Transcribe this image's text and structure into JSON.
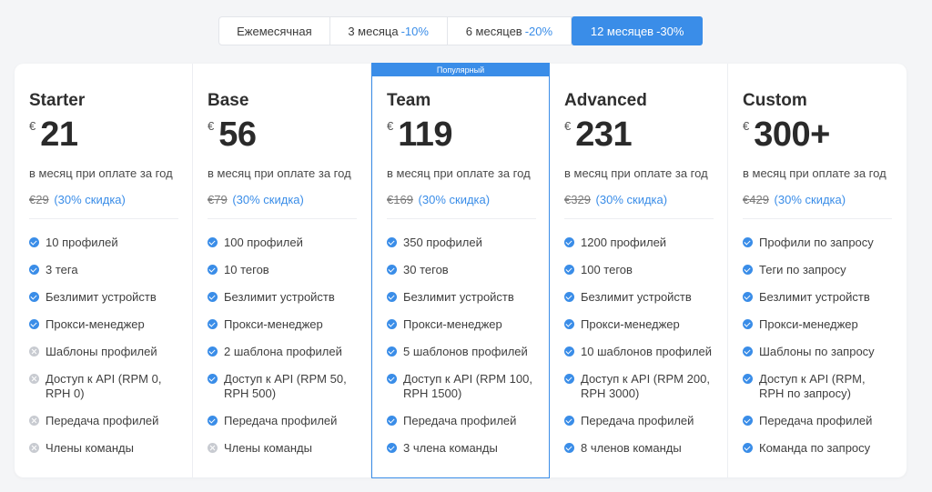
{
  "periods": [
    {
      "label": "Ежемесячная",
      "discount": ""
    },
    {
      "label": "3 месяца",
      "discount": "-10%"
    },
    {
      "label": "6 месяцев",
      "discount": "-20%"
    },
    {
      "label": "12 месяцев",
      "discount": "-30%",
      "active": true
    }
  ],
  "popular_badge": "Популярный",
  "currency": "€",
  "price_note": "в месяц при оплате за год",
  "discount_label": "(30% скидка)",
  "plans": [
    {
      "name": "Starter",
      "price": "21",
      "old_price": "€29",
      "features": [
        {
          "text": "10 профилей",
          "included": true
        },
        {
          "text": "3 тега",
          "included": true
        },
        {
          "text": "Безлимит устройств",
          "included": true
        },
        {
          "text": "Прокси-менеджер",
          "included": true
        },
        {
          "text": "Шаблоны профилей",
          "included": false
        },
        {
          "text": "Доступ к API (RPM 0, RPH 0)",
          "included": false
        },
        {
          "text": "Передача профилей",
          "included": false
        },
        {
          "text": "Члены команды",
          "included": false
        }
      ]
    },
    {
      "name": "Base",
      "price": "56",
      "old_price": "€79",
      "features": [
        {
          "text": "100 профилей",
          "included": true
        },
        {
          "text": "10 тегов",
          "included": true
        },
        {
          "text": "Безлимит устройств",
          "included": true
        },
        {
          "text": "Прокси-менеджер",
          "included": true
        },
        {
          "text": "2 шаблона профилей",
          "included": true
        },
        {
          "text": "Доступ к API (RPM 50, RPH 500)",
          "included": true
        },
        {
          "text": "Передача профилей",
          "included": true
        },
        {
          "text": "Члены команды",
          "included": false
        }
      ]
    },
    {
      "name": "Team",
      "price": "119",
      "old_price": "€169",
      "popular": true,
      "features": [
        {
          "text": "350 профилей",
          "included": true
        },
        {
          "text": "30 тегов",
          "included": true
        },
        {
          "text": "Безлимит устройств",
          "included": true
        },
        {
          "text": "Прокси-менеджер",
          "included": true
        },
        {
          "text": "5 шаблонов профилей",
          "included": true
        },
        {
          "text": "Доступ к API (RPM 100, RPH 1500)",
          "included": true
        },
        {
          "text": "Передача профилей",
          "included": true
        },
        {
          "text": "3 члена команды",
          "included": true
        }
      ]
    },
    {
      "name": "Advanced",
      "price": "231",
      "old_price": "€329",
      "features": [
        {
          "text": "1200 профилей",
          "included": true
        },
        {
          "text": "100 тегов",
          "included": true
        },
        {
          "text": "Безлимит устройств",
          "included": true
        },
        {
          "text": "Прокси-менеджер",
          "included": true
        },
        {
          "text": "10 шаблонов профилей",
          "included": true
        },
        {
          "text": "Доступ к API (RPM 200, RPH 3000)",
          "included": true
        },
        {
          "text": "Передача профилей",
          "included": true
        },
        {
          "text": "8 членов команды",
          "included": true
        }
      ]
    },
    {
      "name": "Custom",
      "price": "300+",
      "old_price": "€429",
      "features": [
        {
          "text": "Профили по запросу",
          "included": true
        },
        {
          "text": "Теги по запросу",
          "included": true
        },
        {
          "text": "Безлимит устройств",
          "included": true
        },
        {
          "text": "Прокси-менеджер",
          "included": true
        },
        {
          "text": "Шаблоны по запросу",
          "included": true
        },
        {
          "text": "Доступ к API (RPM, RPH по запросу)",
          "included": true
        },
        {
          "text": "Передача профилей",
          "included": true
        },
        {
          "text": "Команда по запросу",
          "included": true
        }
      ]
    }
  ],
  "colors": {
    "accent": "#3a8de8",
    "disabled": "#c8cbd1"
  }
}
